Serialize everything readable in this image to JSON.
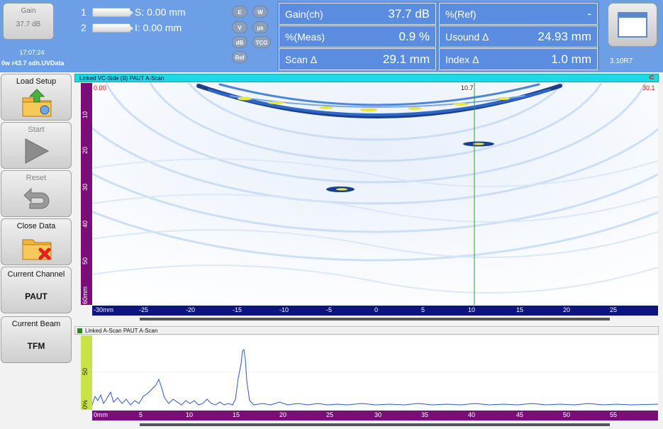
{
  "header": {
    "gain_label": "Gain",
    "gain_value": "37.7 dB",
    "clock": "17:07:24",
    "filename": "0w r43.7 sdh.UVData",
    "cursor1": {
      "num": "1",
      "text": "S: 0.00 mm"
    },
    "cursor2": {
      "num": "2",
      "text": "I: 0.00 mm"
    },
    "mode_buttons": [
      "E",
      "W",
      "V",
      "µs",
      "dB",
      "TCG",
      "Ref"
    ],
    "readings": {
      "gain_ch_label": "Gain(ch)",
      "gain_ch_value": "37.7 dB",
      "ref_label": "%(Ref)",
      "ref_value": "-",
      "meas_label": "%(Meas)",
      "meas_value": "0.9 %",
      "usound_label": "Usound Δ",
      "usound_value": "24.93 mm",
      "scan_label": "Scan Δ",
      "scan_value": "29.1 mm",
      "index_label": "Index Δ",
      "index_value": "1.0 mm"
    },
    "version": "3.10R7"
  },
  "sidebar": {
    "load_setup": "Load Setup",
    "start": "Start",
    "reset": "Reset",
    "close_data": "Close Data",
    "current_channel_label": "Current Channel",
    "current_channel_value": "PAUT",
    "current_beam_label": "Current Beam",
    "current_beam_value": "TFM"
  },
  "bscan": {
    "title": "Linked VC-Side (B) PAUT A-Scan",
    "cursor_left": "0.00",
    "cursor_mid": "10.7",
    "cursor_right": "30.1",
    "v_ticks": [
      "10",
      "20",
      "30",
      "40",
      "50",
      "60mm"
    ],
    "h_ticks": [
      "-30mm",
      "-25",
      "-20",
      "-15",
      "-10",
      "-5",
      "0",
      "5",
      "10",
      "15",
      "20",
      "25"
    ]
  },
  "ascan": {
    "title": "Linked A-Scan PAUT A-Scan",
    "v_ticks": [
      "0%",
      "50"
    ],
    "h_ticks": [
      "0mm",
      "5",
      "10",
      "15",
      "20",
      "25",
      "30",
      "35",
      "40",
      "45",
      "50",
      "55"
    ]
  },
  "colors": {
    "header_bg": "#6d9fe6",
    "readings_bg": "#5a8de0",
    "ruler_purple": "#7a0d7a",
    "ruler_navy": "#0c1480",
    "title_cyan": "#1ed8e6"
  }
}
